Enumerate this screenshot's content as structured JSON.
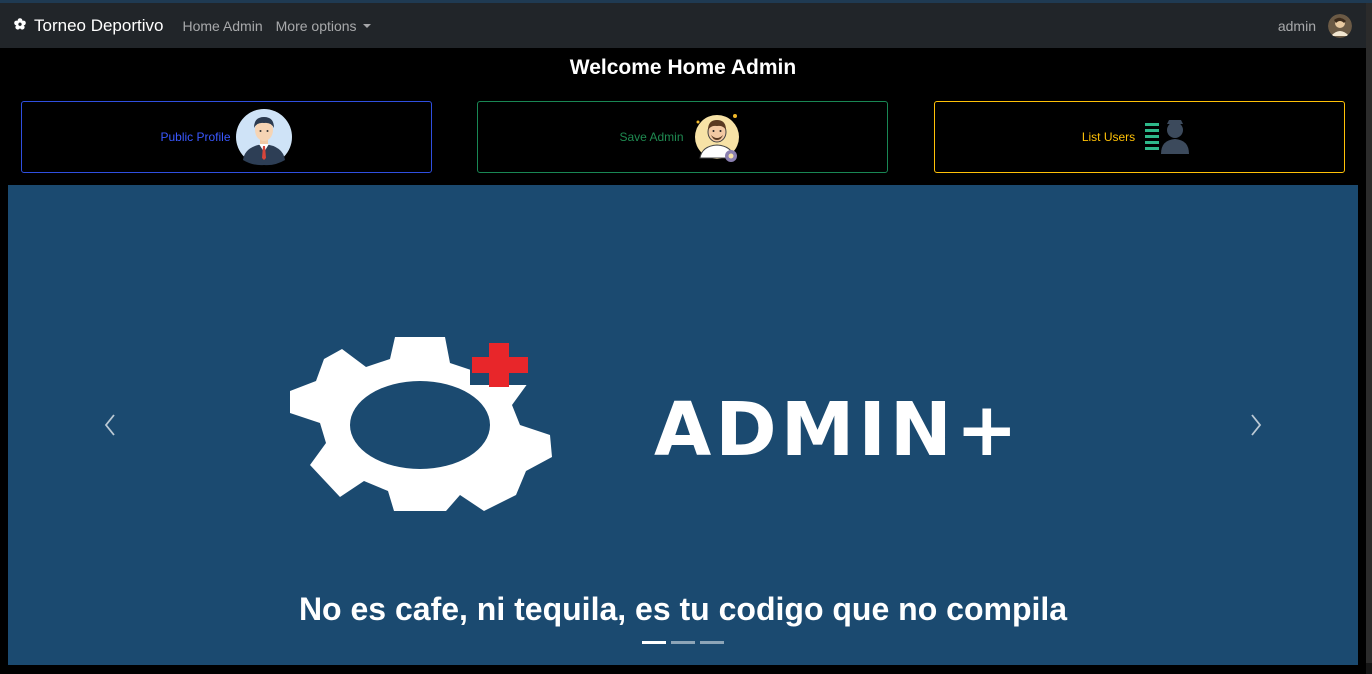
{
  "navbar": {
    "brand": "Torneo Deportivo",
    "links": [
      "Home Admin",
      "More options"
    ],
    "user": "admin"
  },
  "page": {
    "title": "Welcome Home Admin"
  },
  "cards": [
    {
      "label": "Public Profile",
      "color": "#3a58ff",
      "icon": "businessman-avatar-icon"
    },
    {
      "label": "Save Admin",
      "color": "#1f8a51",
      "icon": "admin-gear-avatar-icon"
    },
    {
      "label": "List Users",
      "color": "#ffc107",
      "icon": "user-list-icon"
    }
  ],
  "carousel": {
    "background": "#1b4a70",
    "logo_text": "ADMIN+",
    "caption": "No es cafe, ni tequila, es tu codigo que no compila",
    "slide_count": 3,
    "active_slide": 1
  }
}
